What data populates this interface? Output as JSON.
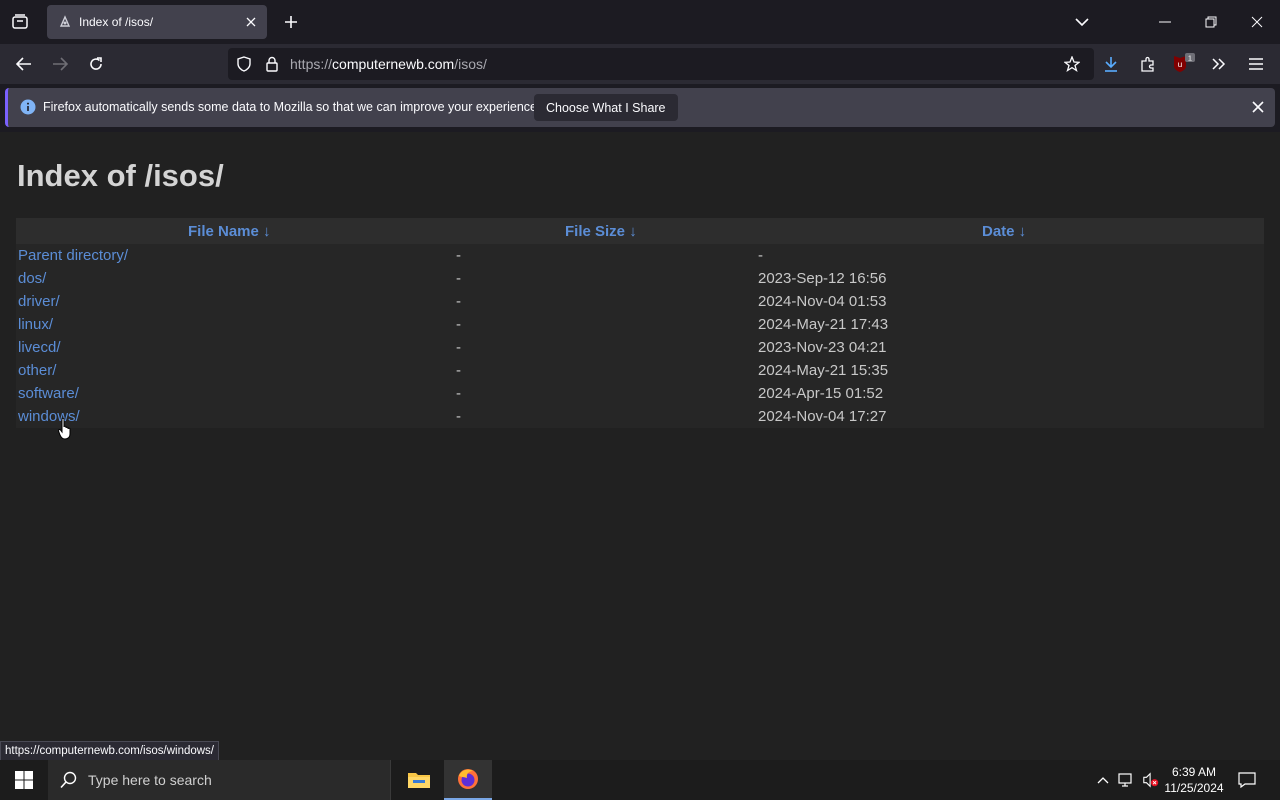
{
  "browser": {
    "tab_title": "Index of /isos/",
    "url_prefix": "https://",
    "url_host": "computernewb.com",
    "url_path": "/isos/",
    "extension_badge": "1"
  },
  "notification": {
    "text": "Firefox automatically sends some data to Mozilla so that we can improve your experience.",
    "button_label": "Choose What I Share"
  },
  "page": {
    "title": "Index of /isos/",
    "columns": [
      "File Name  ↓",
      "File Size  ↓",
      "Date  ↓"
    ],
    "rows": [
      {
        "name": "Parent directory/",
        "size": "-",
        "date": "-"
      },
      {
        "name": "dos/",
        "size": "-",
        "date": "2023-Sep-12 16:56"
      },
      {
        "name": "driver/",
        "size": "-",
        "date": "2024-Nov-04 01:53"
      },
      {
        "name": "linux/",
        "size": "-",
        "date": "2024-May-21 17:43"
      },
      {
        "name": "livecd/",
        "size": "-",
        "date": "2023-Nov-23 04:21"
      },
      {
        "name": "other/",
        "size": "-",
        "date": "2024-May-21 15:35"
      },
      {
        "name": "software/",
        "size": "-",
        "date": "2024-Apr-15 01:52"
      },
      {
        "name": "windows/",
        "size": "-",
        "date": "2024-Nov-04 17:27"
      }
    ]
  },
  "status_link": "https://computernewb.com/isos/windows/",
  "taskbar": {
    "search_placeholder": "Type here to search",
    "time": "6:39 AM",
    "date": "11/25/2024"
  },
  "colors": {
    "link": "#5b8dd6",
    "page_bg": "#212121",
    "accent": "#7aa7e6"
  }
}
